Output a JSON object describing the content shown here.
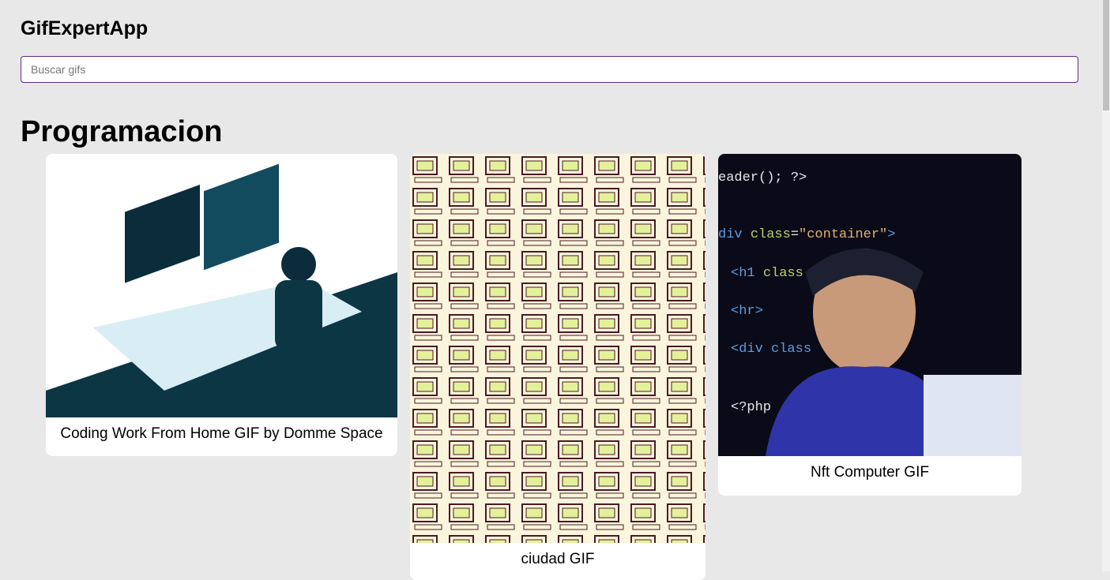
{
  "header": {
    "title": "GifExpertApp"
  },
  "search": {
    "placeholder": "Buscar gifs",
    "value": ""
  },
  "categories": [
    {
      "name": "Programacion",
      "gifs": [
        {
          "title": "Coding Work From Home GIF by Domme Space"
        },
        {
          "title": "ciudad GIF"
        },
        {
          "title": "Nft Computer GIF"
        }
      ]
    }
  ],
  "colors": {
    "background": "#e8e8e8",
    "input_border": "#5b2d86",
    "card": "#ffffff"
  }
}
